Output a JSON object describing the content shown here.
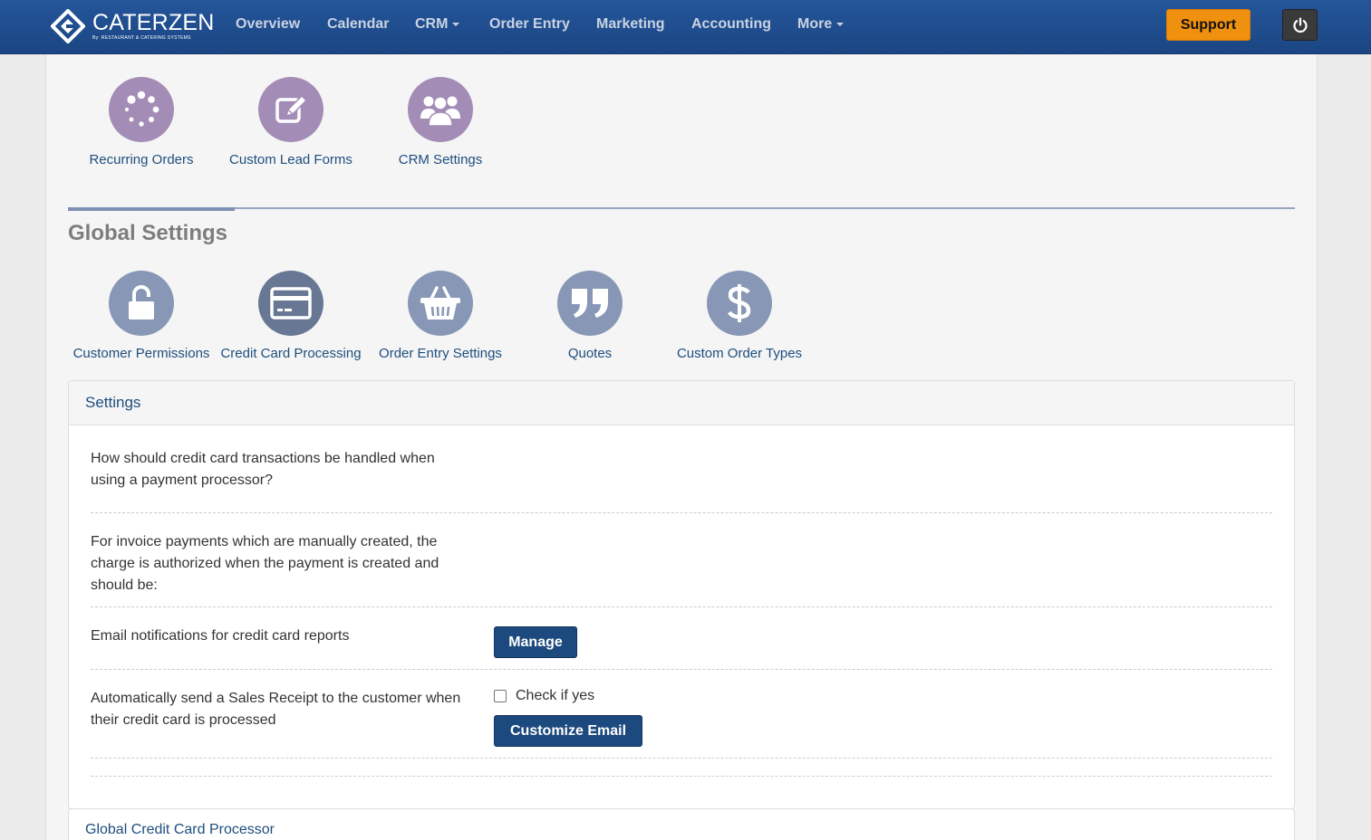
{
  "brand": {
    "name": "CATERZEN",
    "tagline": "By: RESTAURANT & CATERING SYSTEMS"
  },
  "nav": {
    "items": [
      {
        "label": "Overview"
      },
      {
        "label": "Calendar"
      },
      {
        "label": "CRM"
      },
      {
        "label": "Order Entry"
      },
      {
        "label": "Marketing"
      },
      {
        "label": "Accounting"
      },
      {
        "label": "More"
      }
    ],
    "support": "Support"
  },
  "crm_tiles": [
    {
      "label": "Recurring Orders",
      "icon": "loading-dots-icon"
    },
    {
      "label": "Custom Lead Forms",
      "icon": "edit-icon"
    },
    {
      "label": "CRM Settings",
      "icon": "users-group-icon"
    }
  ],
  "global": {
    "title": "Global Settings",
    "tiles": [
      {
        "label": "Customer Permissions",
        "icon": "unlock-icon"
      },
      {
        "label": "Credit Card Processing",
        "icon": "credit-card-icon"
      },
      {
        "label": "Order Entry Settings",
        "icon": "basket-icon"
      },
      {
        "label": "Quotes",
        "icon": "quote-icon"
      },
      {
        "label": "Custom Order Types",
        "icon": "dollar-icon"
      }
    ]
  },
  "settings_panel": {
    "title": "Settings",
    "rows": [
      {
        "label": "How should credit card transactions be handled when using a payment processor?"
      },
      {
        "label": "For invoice payments which are manually created, the charge is authorized when the payment is created and should be:"
      },
      {
        "label": "Email notifications for credit card reports",
        "button": "Manage"
      },
      {
        "label": "Automatically send a Sales Receipt to the customer when their credit card is processed",
        "checkbox_label": "Check if yes",
        "checked": false,
        "button": "Customize Email"
      }
    ]
  },
  "panel2": {
    "title": "Global Credit Card Processor"
  },
  "colors": {
    "navbar": "#1f4d8f",
    "support": "#f0900f",
    "accent_purple": "#a38db7",
    "accent_slate": "#8797b5",
    "button": "#1d4a7e"
  }
}
